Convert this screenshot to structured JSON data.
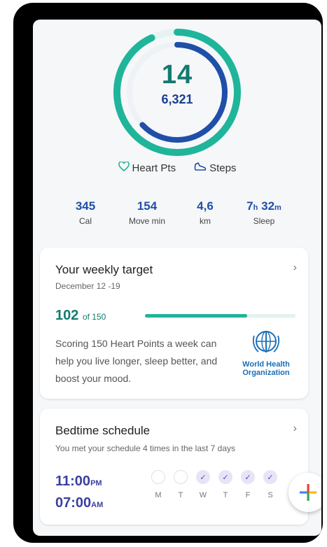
{
  "summary": {
    "heart_points": "14",
    "steps": "6,321",
    "heart_fraction": 0.93,
    "steps_fraction": 0.63
  },
  "legend": {
    "heart_label": "Heart Pts",
    "steps_label": "Steps"
  },
  "stats": [
    {
      "value": "345",
      "unit": "",
      "label": "Cal"
    },
    {
      "value": "154",
      "unit": "",
      "label": "Move min"
    },
    {
      "value": "4,6",
      "unit": "",
      "label": "km"
    },
    {
      "value_hours": "7",
      "unit_hours": "h",
      "value_min": "32",
      "unit_min": "m",
      "label": "Sleep"
    }
  ],
  "weekly_target": {
    "title": "Your weekly target",
    "dates": "December 12 -19",
    "current": "102",
    "of_label": "of 150",
    "progress_fraction": 0.68,
    "description": "Scoring 150 Heart Points a week can help you live longer, sleep better, and boost your mood.",
    "source_line1": "World Health",
    "source_line2": "Organization"
  },
  "bedtime": {
    "title": "Bedtime schedule",
    "subtitle": "You met your schedule 4 times in the last 7 days",
    "bed_time": "11:00",
    "bed_ampm": "PM",
    "wake_time": "07:00",
    "wake_ampm": "AM",
    "days": [
      {
        "label": "M",
        "met": false
      },
      {
        "label": "T",
        "met": false
      },
      {
        "label": "W",
        "met": true
      },
      {
        "label": "T",
        "met": true
      },
      {
        "label": "F",
        "met": true
      },
      {
        "label": "S",
        "met": true
      }
    ]
  },
  "colors": {
    "heart": "#1fb59a",
    "steps": "#1f4fa8",
    "accent": "#137a70"
  },
  "icons": {
    "heart": "heart-outline-icon",
    "steps": "shoe-icon",
    "chevron": "chevron-right-icon",
    "fab": "plus-icon"
  }
}
